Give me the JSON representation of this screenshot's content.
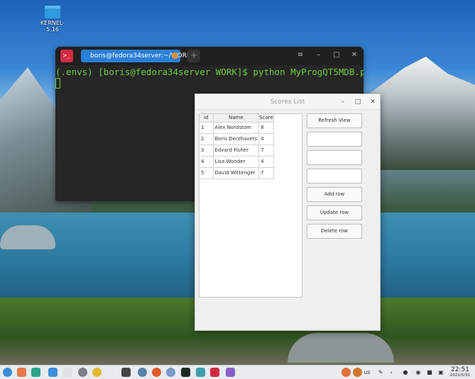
{
  "desktop": {
    "icon_label": "KERNEL-5.16"
  },
  "terminal": {
    "app_icon": ">_",
    "tab_label": "boris@fedora34server:~/WORK",
    "new_tab": "+",
    "menu_icon": "≡",
    "minimize": "–",
    "maximize": "□",
    "close": "✕",
    "command_line": "(.envs) [boris@fedora34server WORK]$ python MyProgQT5MDB.py"
  },
  "scores_window": {
    "title": "Scores List",
    "minimize": "–",
    "maximize": "□",
    "close": "✕",
    "table": {
      "headers": [
        "id",
        "Name",
        "Score"
      ],
      "rows": [
        [
          "1",
          "Alex Nordstom",
          "8"
        ],
        [
          "2",
          "Boris Derzhavets",
          "4"
        ],
        [
          "3",
          "Edvard Fisher",
          "7"
        ],
        [
          "4",
          "Lisa Wonder",
          "4"
        ],
        [
          "5",
          "David Wittenger",
          "7"
        ]
      ]
    },
    "buttons": {
      "refresh": "Refresh View",
      "add": "Add row",
      "update": "Update row",
      "delete": "Delete row"
    },
    "fields": [
      "",
      "",
      ""
    ]
  },
  "taskbar": {
    "keyboard_layout": "us",
    "clock_time": "22:51",
    "clock_date": "2021/5/31",
    "colors": {
      "terminal_red": "#d12b3f",
      "tab_blue": "#2a7fd6",
      "terminal_green": "#6ccf3a"
    }
  }
}
